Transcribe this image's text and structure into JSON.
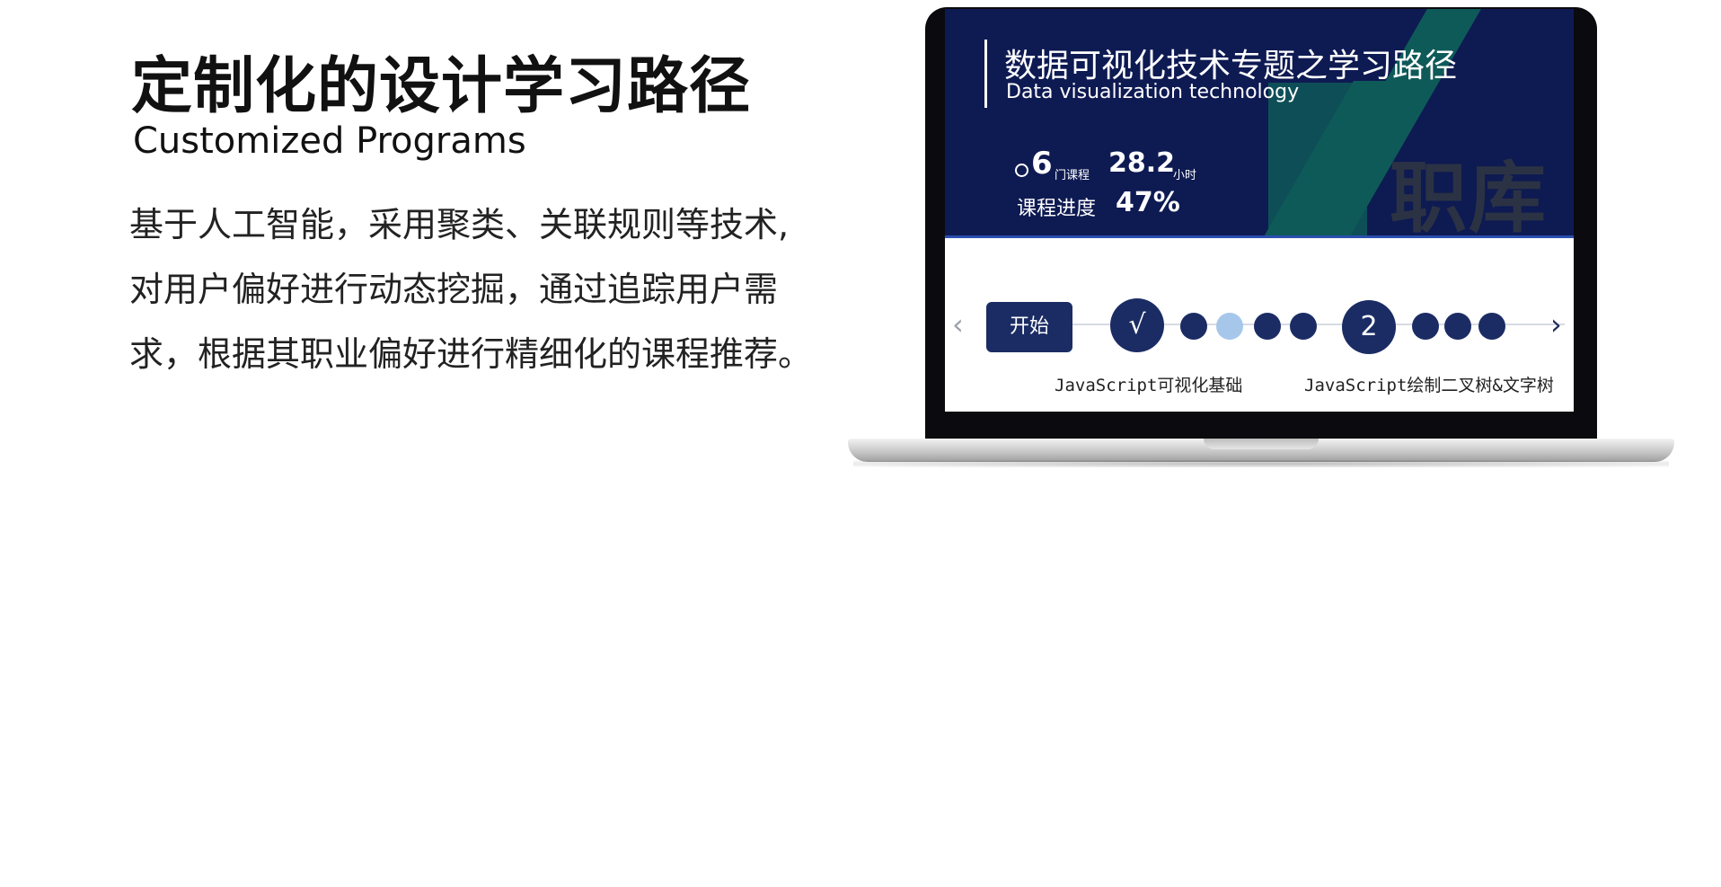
{
  "title": "定制化的设计学习路径",
  "subtitle": "Customized Programs",
  "description": [
    "基于人工智能，采用聚类、关联规则等技术,",
    "对用户偏好进行动态挖掘，通过追踪用户需",
    "求，根据其职业偏好进行精细化的课程推荐。"
  ],
  "screen": {
    "title": "数据可视化技术专题之学习路径",
    "subtitle": "Data visualization technology",
    "brand_text": "职库",
    "courses_count": "6",
    "courses_unit": "门课程",
    "hours_value": "28.2",
    "hours_unit": "小时",
    "progress_label": "课程进度",
    "progress_value": "47%",
    "start_label": "开始",
    "node_done_symbol": "√",
    "node_two_label": "2",
    "left_arrow": "‹",
    "right_arrow": "›",
    "course_labels": [
      "JavaScript可视化基础",
      "JavaScript绘制二叉树&文字树"
    ],
    "colors": {
      "navy": "#0e1a52",
      "node": "#1b2c64",
      "accent_teal": "#0e5a58",
      "light_dot": "#a7c7ea"
    }
  }
}
